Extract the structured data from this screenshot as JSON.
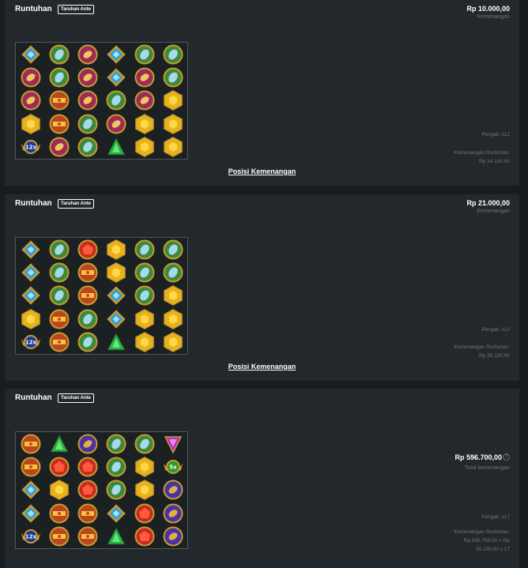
{
  "rounds": [
    {
      "title": "Runtuhan",
      "badge": "Taruhan Ante",
      "amount": "Rp 10.000,00",
      "amount_label": "Kemenangan",
      "multiplier": "Pengali: x12",
      "cascade_label": "Kemenangan Runtuhan:",
      "cascade_value": "Rp 14.100,00",
      "link": "Posisi Kemenangan",
      "grid": [
        [
          "diamond",
          "stone",
          "ring",
          "diamond",
          "stone",
          "stone"
        ],
        [
          "ring",
          "stone",
          "ring",
          "diamond",
          "ring",
          "stone"
        ],
        [
          "ring",
          "crown",
          "ring",
          "stone",
          "ring",
          "hexagon"
        ],
        [
          "hexagon",
          "crown",
          "stone",
          "ring",
          "hexagon",
          "hexagon"
        ],
        [
          "mult-12x",
          "ring",
          "stone",
          "triangle",
          "hexagon",
          "hexagon"
        ]
      ]
    },
    {
      "title": "Runtuhan",
      "badge": "Taruhan Ante",
      "amount": "Rp 21.000,00",
      "amount_label": "Kemenangan",
      "multiplier": "Pengali: x12",
      "cascade_label": "Kemenangan Runtuhan:",
      "cascade_value": "Rp 35.100,00",
      "link": "Posisi Kemenangan",
      "grid": [
        [
          "diamond",
          "stone",
          "ruby",
          "hexagon",
          "stone",
          "stone"
        ],
        [
          "diamond",
          "stone",
          "crown",
          "hexagon",
          "stone",
          "stone"
        ],
        [
          "diamond",
          "stone",
          "crown",
          "diamond",
          "stone",
          "hexagon"
        ],
        [
          "hexagon",
          "crown",
          "stone",
          "diamond",
          "hexagon",
          "hexagon"
        ],
        [
          "mult-12x",
          "crown",
          "stone",
          "triangle",
          "hexagon",
          "hexagon"
        ]
      ]
    },
    {
      "title": "Runtuhan",
      "badge": "Taruhan Ante",
      "amount": "Rp 596.700,00",
      "amount_label": "Total kemenangan",
      "help": "?",
      "multiplier": "Pengali: x17",
      "cascade_label": "Kemenangan Runtuhan:",
      "cascade_value": "Rp 596.700,00 = Rp",
      "cascade_value2": "35.100,00 x 17",
      "grid": [
        [
          "crown",
          "triangle",
          "sapphire",
          "stone",
          "stone",
          "amethyst"
        ],
        [
          "crown",
          "ruby",
          "ruby",
          "stone",
          "hexagon",
          "mult-5x"
        ],
        [
          "diamond",
          "hexagon",
          "ruby",
          "stone",
          "hexagon",
          "sapphire"
        ],
        [
          "diamond",
          "crown",
          "crown",
          "diamond",
          "ruby",
          "sapphire"
        ],
        [
          "mult-12x",
          "crown",
          "crown",
          "triangle",
          "ruby",
          "sapphire"
        ]
      ]
    }
  ],
  "symbol_colors": {
    "diamond": "#2f9fd8",
    "stone": "#3a8a3a",
    "ring": "#9c2b5a",
    "crown": "#b8471f",
    "hexagon": "#e7b21c",
    "triangle": "#23b53f",
    "ruby": "#c62b22",
    "sapphire": "#4a33a3",
    "amethyst": "#b02fc4",
    "mult": "#1a3a9a",
    "mult-5x": "#2a9a2a",
    "frame": "#c99a2e"
  }
}
